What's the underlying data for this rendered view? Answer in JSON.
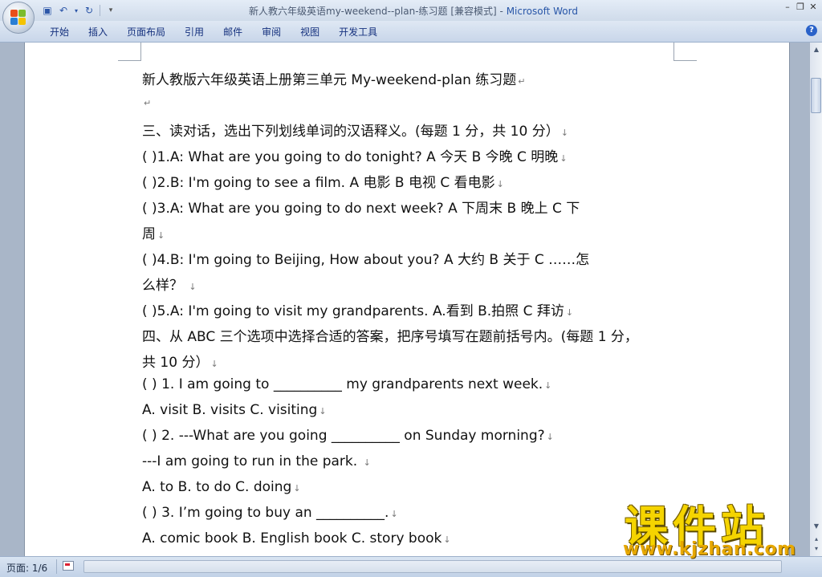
{
  "window": {
    "title": "新人教六年级英语my-weekend--plan-练习题 [兼容模式] - ",
    "app_name": "Microsoft Word"
  },
  "quick_access": {
    "icons": [
      "save-icon",
      "undo-icon",
      "redo-icon",
      "customize-icon"
    ]
  },
  "ribbon": {
    "tabs": [
      "开始",
      "插入",
      "页面布局",
      "引用",
      "邮件",
      "审阅",
      "视图",
      "开发工具"
    ]
  },
  "document": {
    "lines": [
      "新人教版六年级英语上册第三单元 My-weekend-plan 练习题",
      "",
      "三、读对话，选出下列划线单词的汉语释义。(每题 1 分，共 10 分）",
      "(      )1.A:  What are you going to do tonight?     A 今天         B 今晚         C 明晚",
      "(      )2.B:  I'm going to see a film.                   A 电影         B  电视         C 看电影",
      "(      )3.A:  What are you going to do next week?   A 下周末       B 晚上         C 下",
      "周",
      "(      )4.B:  I'm going to Beijing, How about you?   A  大约        B 关于       C ……怎",
      "么样？ ",
      "(      )5.A:  I'm going to visit my grandparents.     A.看到       B.拍照     C 拜访",
      "四、从 ABC 三个选项中选择合适的答案，把序号填写在题前括号内。(每题 1 分，",
      "共 10 分）",
      "(      ) 1. I am going to __________  my grandparents next week.",
      "      A. visit                     B. visits                     C. visiting",
      "(      ) 2. ---What are you going __________  on Sunday morning?",
      "      ---I am going to run in the park.  ",
      "       A. to                        B. to do                       C. doing",
      "(      ) 3. I’m going to buy an __________.",
      "             A. comic book               B. English book          C. story book"
    ]
  },
  "status_bar": {
    "page": "页面: 1/6"
  },
  "watermark": {
    "chinese": "课件站",
    "url": "www.kjzhan.com"
  }
}
